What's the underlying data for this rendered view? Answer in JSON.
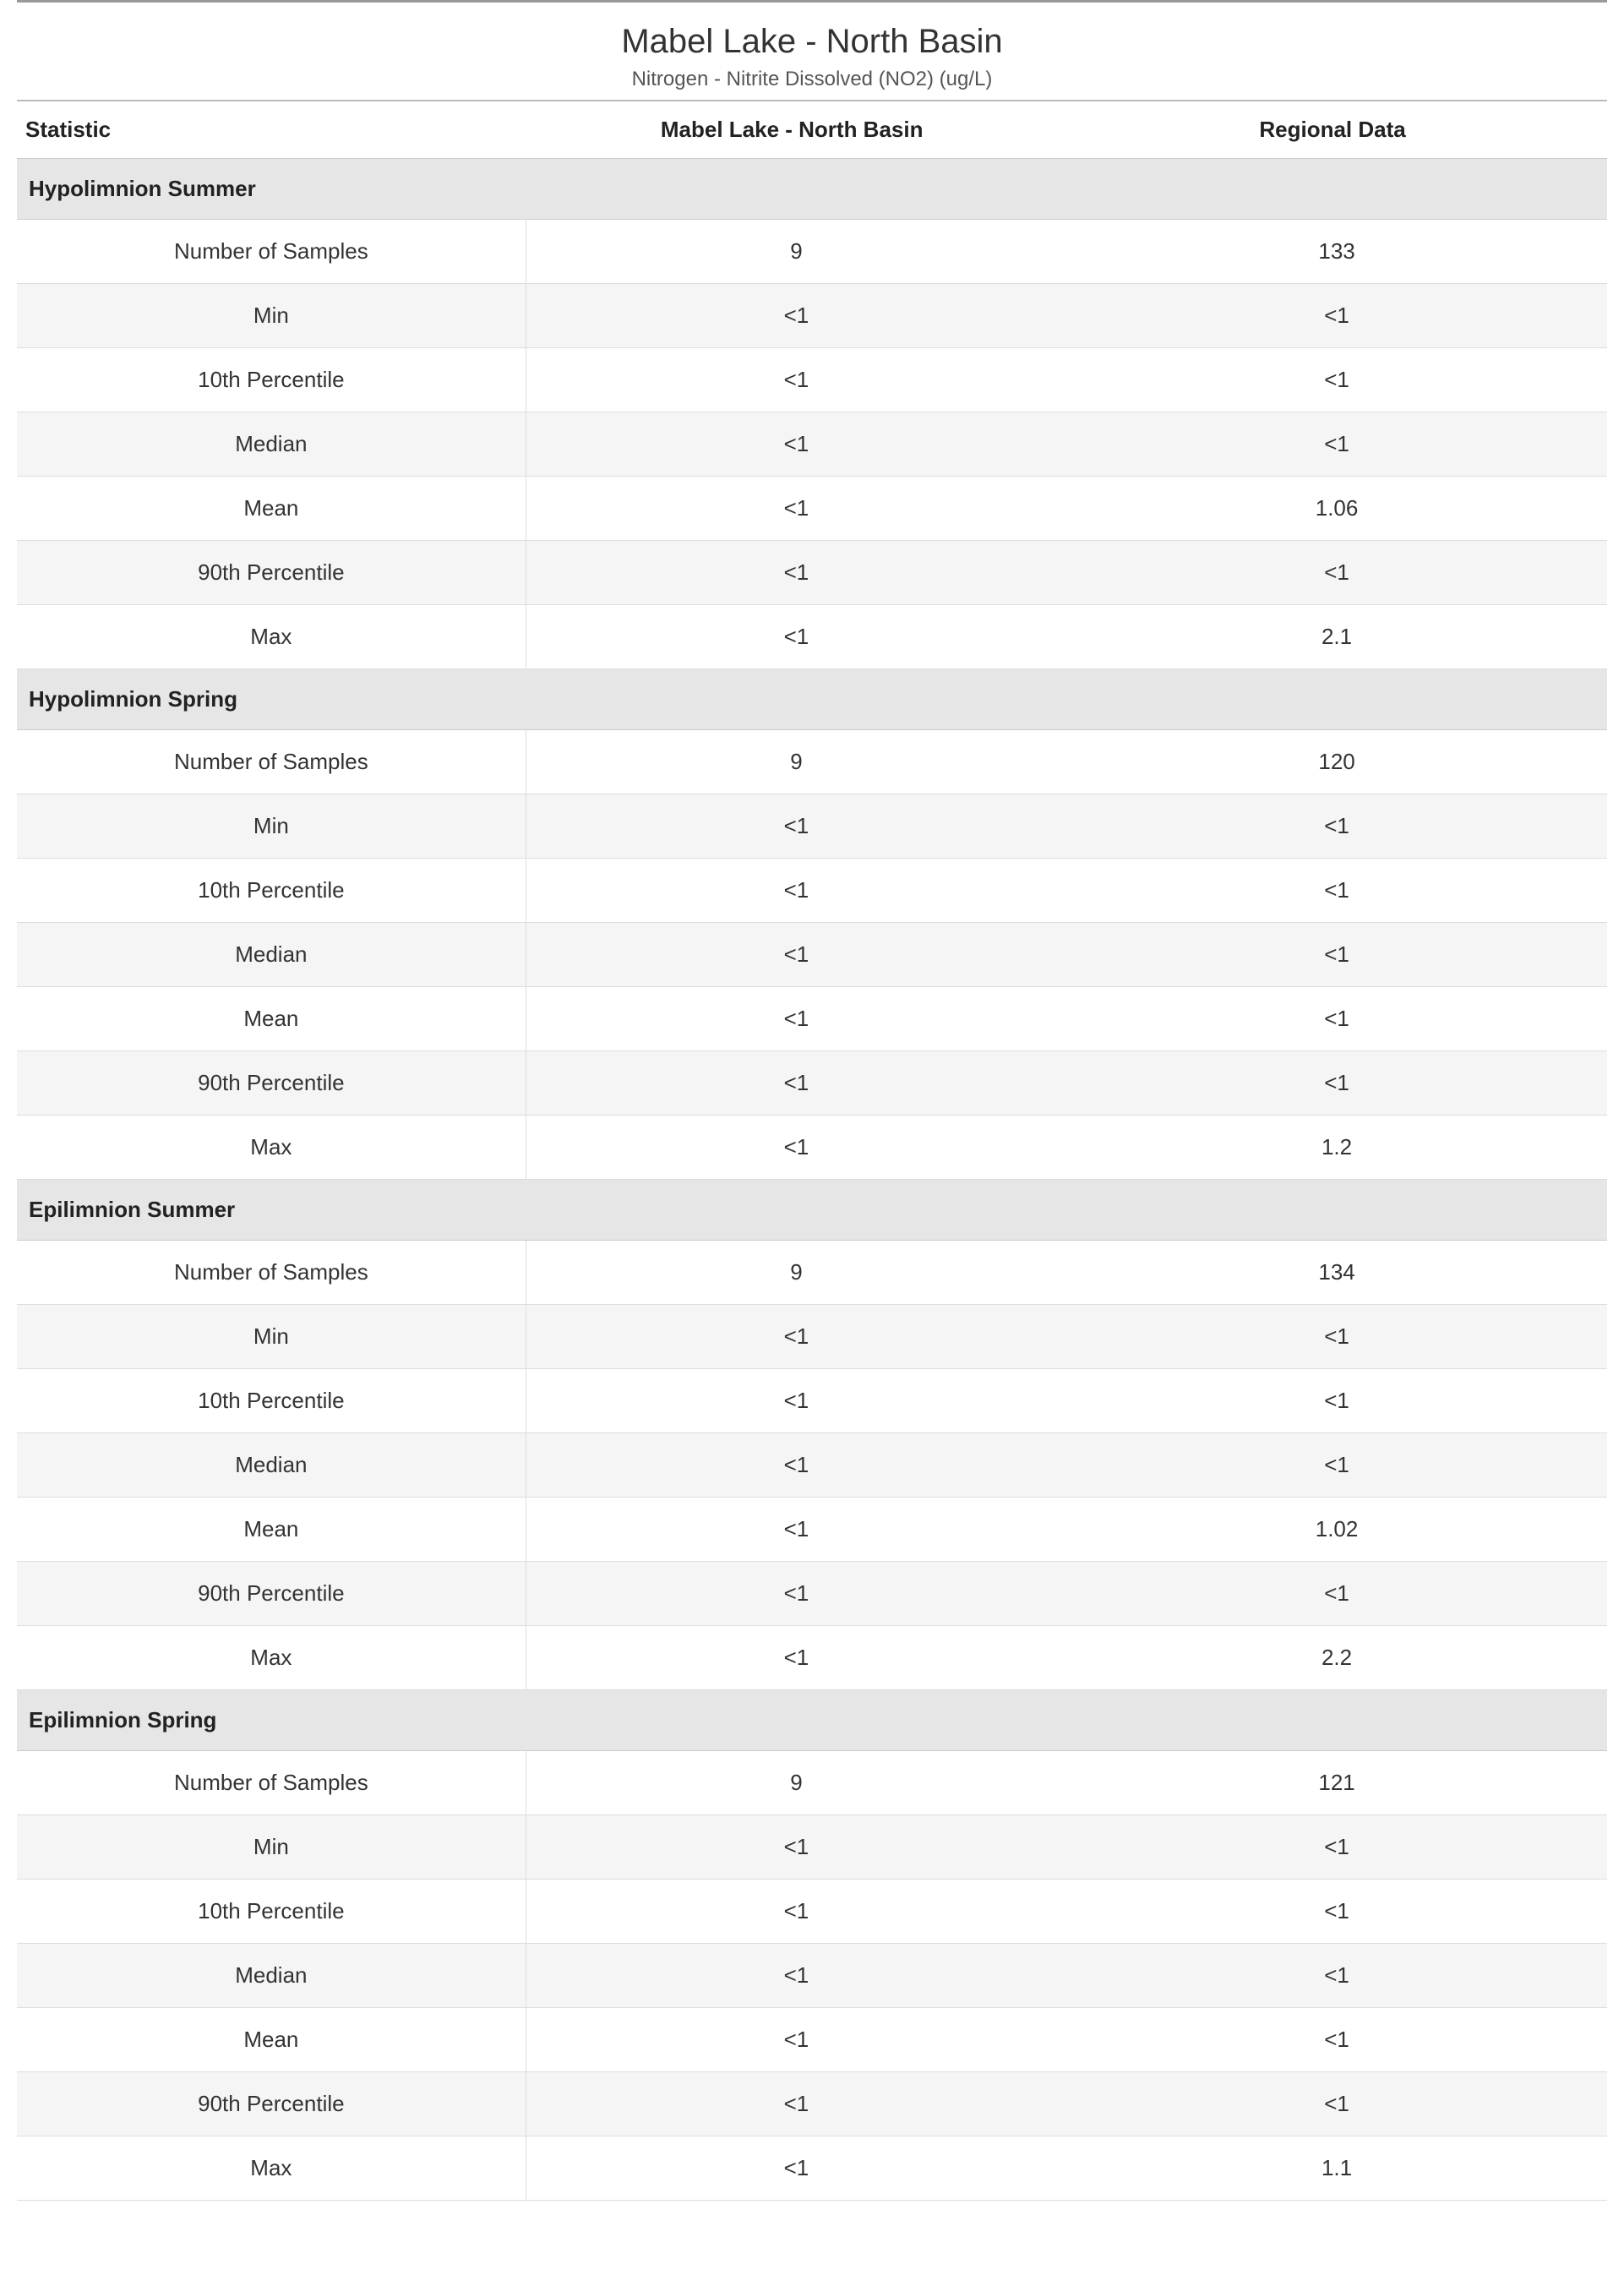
{
  "title": "Mabel Lake - North Basin",
  "subtitle": "Nitrogen - Nitrite Dissolved (NO2) (ug/L)",
  "columns": {
    "stat": "Statistic",
    "site": "Mabel Lake - North Basin",
    "regional": "Regional Data"
  },
  "stat_labels": [
    "Number of Samples",
    "Min",
    "10th Percentile",
    "Median",
    "Mean",
    "90th Percentile",
    "Max"
  ],
  "sections": [
    {
      "name": "Hypolimnion Summer",
      "site": [
        "9",
        "<1",
        "<1",
        "<1",
        "<1",
        "<1",
        "<1"
      ],
      "regional": [
        "133",
        "<1",
        "<1",
        "<1",
        "1.06",
        "<1",
        "2.1"
      ]
    },
    {
      "name": "Hypolimnion Spring",
      "site": [
        "9",
        "<1",
        "<1",
        "<1",
        "<1",
        "<1",
        "<1"
      ],
      "regional": [
        "120",
        "<1",
        "<1",
        "<1",
        "<1",
        "<1",
        "1.2"
      ]
    },
    {
      "name": "Epilimnion Summer",
      "site": [
        "9",
        "<1",
        "<1",
        "<1",
        "<1",
        "<1",
        "<1"
      ],
      "regional": [
        "134",
        "<1",
        "<1",
        "<1",
        "1.02",
        "<1",
        "2.2"
      ]
    },
    {
      "name": "Epilimnion Spring",
      "site": [
        "9",
        "<1",
        "<1",
        "<1",
        "<1",
        "<1",
        "<1"
      ],
      "regional": [
        "121",
        "<1",
        "<1",
        "<1",
        "<1",
        "<1",
        "1.1"
      ]
    }
  ]
}
